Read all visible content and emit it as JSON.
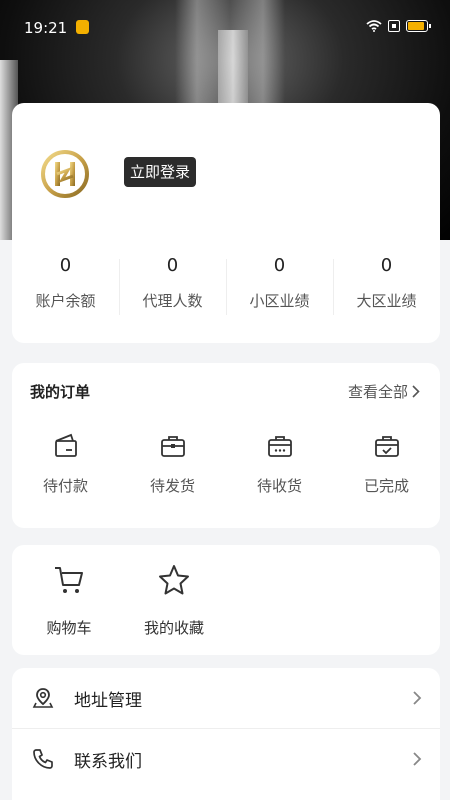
{
  "status_bar": {
    "time": "19:21"
  },
  "profile": {
    "login_label": "立即登录",
    "stats": [
      {
        "value": "0",
        "label": "账户余额"
      },
      {
        "value": "0",
        "label": "代理人数"
      },
      {
        "value": "0",
        "label": "小区业绩"
      },
      {
        "value": "0",
        "label": "大区业绩"
      }
    ]
  },
  "orders": {
    "title": "我的订单",
    "view_all": "查看全部",
    "items": [
      {
        "label": "待付款",
        "icon": "wallet-icon"
      },
      {
        "label": "待发货",
        "icon": "package-icon"
      },
      {
        "label": "待收货",
        "icon": "delivery-box-icon"
      },
      {
        "label": "已完成",
        "icon": "completed-box-icon"
      }
    ]
  },
  "tools": [
    {
      "label": "购物车",
      "icon": "cart-icon"
    },
    {
      "label": "我的收藏",
      "icon": "star-icon"
    }
  ],
  "menu": [
    {
      "label": "地址管理",
      "icon": "location-icon"
    },
    {
      "label": "联系我们",
      "icon": "phone-icon"
    }
  ],
  "colors": {
    "accent_gold": "#c9a24a",
    "battery": "#f4b000",
    "dark_button": "#2c2c2c"
  }
}
